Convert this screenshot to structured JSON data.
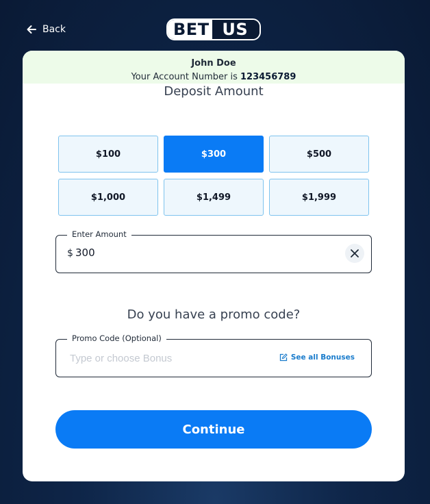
{
  "header": {
    "back_label": "Back",
    "logo_left": "BET",
    "logo_right": "US"
  },
  "account": {
    "name": "John Doe",
    "number_prefix": "Your Account Number is ",
    "number": "123456789"
  },
  "deposit": {
    "title": "Deposit Amount",
    "amounts": [
      {
        "label": "$100",
        "selected": false
      },
      {
        "label": "$300",
        "selected": true
      },
      {
        "label": "$500",
        "selected": false
      },
      {
        "label": "$1,000",
        "selected": false
      },
      {
        "label": "$1,499",
        "selected": false
      },
      {
        "label": "$1,999",
        "selected": false
      }
    ],
    "amount_field": {
      "label": "Enter Amount",
      "currency": "$",
      "value": "300"
    }
  },
  "promo": {
    "question": "Do you have a promo code?",
    "field_label": "Promo Code (Optional)",
    "placeholder": "Type or choose Bonus",
    "see_all_label": "See all Bonuses"
  },
  "continue_label": "Continue",
  "colors": {
    "accent": "#0a7bf5",
    "account_bg": "#edfbe9",
    "chip_bg": "#eef7fd",
    "chip_border": "#7ec3ee",
    "link": "#1a7ccc"
  },
  "icons": {
    "back": "arrow-left-icon",
    "clear": "close-icon",
    "see_all": "edit-icon"
  }
}
